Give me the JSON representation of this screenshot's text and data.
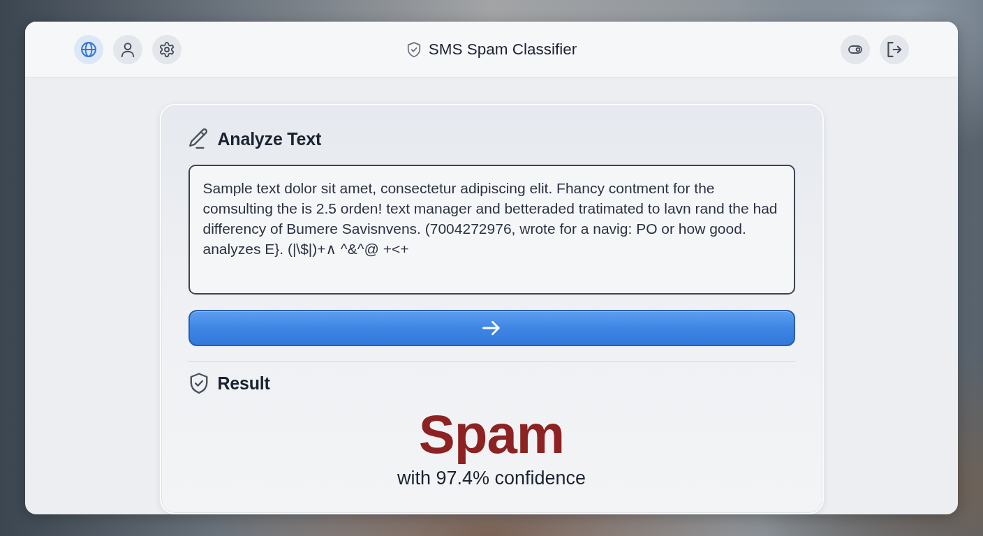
{
  "header": {
    "title": "SMS Spam Classifier",
    "nav_buttons": [
      {
        "selected": true
      },
      {
        "selected": false
      },
      {
        "selected": false
      }
    ]
  },
  "analyze": {
    "heading": "Analyze Text",
    "message": "Sample text dolor sit amet, consectetur adipiscing elit. Fhancy contment for the comsulting the is 2.5 orden! text manager and betteraded tratimated to lavn rand the had differency of Bumere Savisnvens. (7004272976, wrote for a navig: PO or how good. analyzes E}. (|\\$|)+∧ ^&^@ +<+"
  },
  "result": {
    "heading": "Result",
    "kind": "spam",
    "label": "Spam",
    "confidence": "with 97.4% confidence"
  }
}
